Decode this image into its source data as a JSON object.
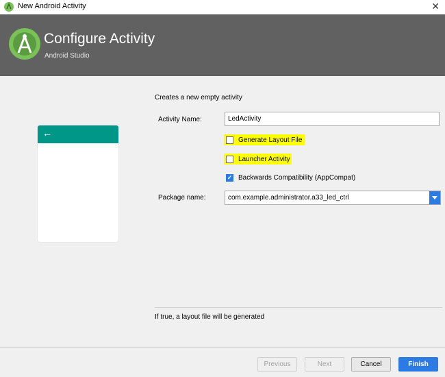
{
  "window": {
    "title": "New Android Activity",
    "close_glyph": "✕"
  },
  "header": {
    "title": "Configure Activity",
    "subtitle": "Android Studio"
  },
  "preview": {
    "back_glyph": "←"
  },
  "form": {
    "description": "Creates a new empty activity",
    "activity_name_label": "Activity Name:",
    "activity_name_value": "LedActivity",
    "generate_layout_label": "Generate Layout File",
    "generate_layout_checked": false,
    "launcher_activity_label": "Launcher Activity",
    "launcher_activity_checked": false,
    "backwards_compat_label": "Backwards Compatibility (AppCompat)",
    "backwards_compat_checked": true,
    "package_name_label": "Package name:",
    "package_name_value": "com.example.administrator.a33_led_ctrl"
  },
  "hint": "If true, a layout file will be generated",
  "buttons": {
    "previous": "Previous",
    "next": "Next",
    "cancel": "Cancel",
    "finish": "Finish"
  },
  "colors": {
    "header_bg": "#616161",
    "accent": "#2c7be5",
    "highlight": "#ffff00",
    "preview_bar": "#009688"
  }
}
